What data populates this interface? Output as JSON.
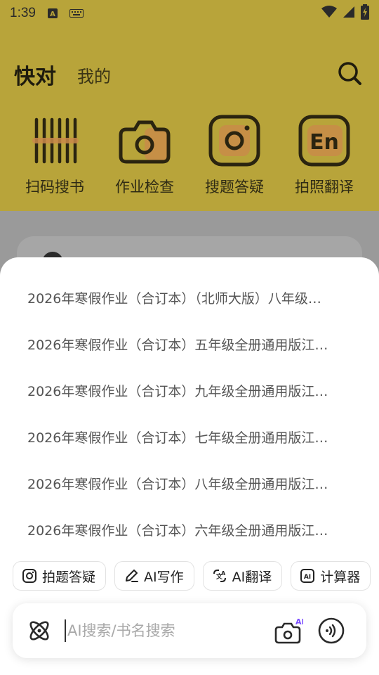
{
  "status_bar": {
    "time": "1:39",
    "left_icons": [
      "a-notification-icon",
      "keyboard-icon"
    ],
    "right_icons": [
      "wifi-icon",
      "signal-icon",
      "battery-charging-icon"
    ]
  },
  "header": {
    "tabs": [
      {
        "label": "快对",
        "active": true
      },
      {
        "label": "我的",
        "active": false
      }
    ],
    "search_icon": "search-icon"
  },
  "tools": [
    {
      "label": "扫码搜书",
      "icon": "barcode-icon"
    },
    {
      "label": "作业检查",
      "icon": "camera-check-icon"
    },
    {
      "label": "搜题答疑",
      "icon": "camera-search-icon"
    },
    {
      "label": "拍照翻译",
      "icon": "translate-en-icon"
    }
  ],
  "suggestions": [
    "2026年寒假作业（合订本）（北师大版）八年级…",
    "2026年寒假作业（合订本）五年级全册通用版江…",
    "2026年寒假作业（合订本）九年级全册通用版江…",
    "2026年寒假作业（合订本）七年级全册通用版江…",
    "2026年寒假作业（合订本）八年级全册通用版江…",
    "2026年寒假作业（合订本）六年级全册通用版江…"
  ],
  "chips": [
    {
      "label": "拍题答疑",
      "icon": "camera-icon"
    },
    {
      "label": "AI写作",
      "icon": "pen-icon"
    },
    {
      "label": "AI翻译",
      "icon": "translate-icon"
    },
    {
      "label": "计算器",
      "icon": "ai-calculator-icon"
    }
  ],
  "search": {
    "placeholder": "AI搜索/书名搜索",
    "value": "",
    "camera_badge": "AI"
  },
  "colors": {
    "header_bg_dimmed": "#b8a43a",
    "overlay": "#9a9a9a",
    "accent_purple": "#7b4dff"
  }
}
